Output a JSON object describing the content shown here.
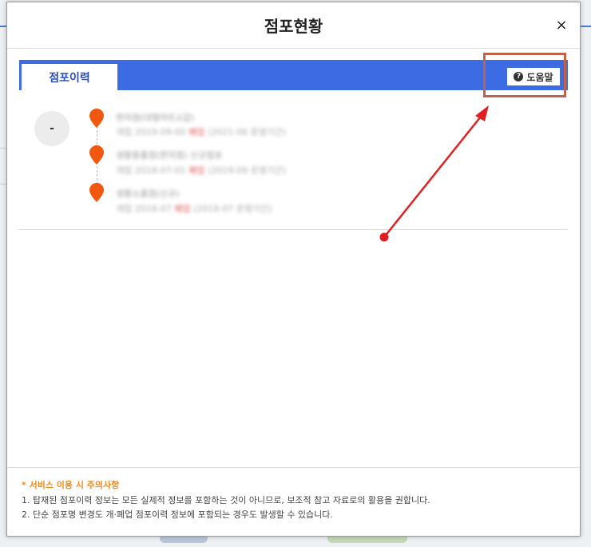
{
  "modal": {
    "title": "점포현황",
    "close_label": "×"
  },
  "tabs": [
    {
      "label": "점포이력",
      "active": true
    }
  ],
  "help_button": {
    "label": "도움말",
    "icon": "question-circle-icon"
  },
  "store": {
    "avatar_text": "-"
  },
  "history": [
    {
      "name": "편의점(대형마트)(갑)",
      "date": "개업 2019-09-00",
      "status": "폐업",
      "detail": "(2021-06 운영기간)"
    },
    {
      "name": "생활용품점(편의점) 신규점포",
      "date": "개업 2018-07-01",
      "status": "폐업",
      "detail": "(2019-09 운영기간)"
    },
    {
      "name": "생활소품점(신규)",
      "date": "개업 2016-07",
      "status": "폐업",
      "detail": "(2018-07 운영기간)"
    }
  ],
  "notice": {
    "title": "* 서비스 이용 시 주의사항",
    "lines": [
      "1. 탑재된 점포이력 정보는 모든 실제적 정보를 포함하는 것이 아니므로, 보조적 참고 자료로의 활용을 권합니다.",
      "2. 단순 점포명 변경도 개·폐업 점포이력 정보에 포함되는 경우도 발생할 수 있습니다."
    ]
  },
  "colors": {
    "accent": "#3d6be3",
    "pin": "#f0580f",
    "notice": "#f08a1c",
    "annotation": "#e02020",
    "highlight": "#c0614a"
  }
}
